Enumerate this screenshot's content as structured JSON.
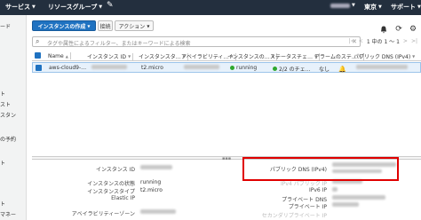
{
  "topbar": {
    "services": "サービス",
    "resource_groups": "リソースグループ",
    "region": "東京",
    "support": "サポート"
  },
  "sidebar": {
    "items": [
      "ード",
      "ト",
      "スト",
      "スタン",
      "の予約",
      "ト",
      "ト",
      "マネー"
    ]
  },
  "toolbar": {
    "launch_label": "インスタンスの作成",
    "connect_label": "接続",
    "actions_label": "アクション"
  },
  "filter": {
    "placeholder": "タグや属性によるフィルター、またはキーワードによる検索",
    "pager": "1 中の 1 ～ 1"
  },
  "table": {
    "columns": [
      "Name",
      "インスタンス ID",
      "インスタンスタ…",
      "アベイラビリティ…",
      "インスタンスの…",
      "ステータスチェ…",
      "アラームのステ…",
      "パブリック DNS (IPv4)"
    ],
    "rows": [
      {
        "name": "aws-cloud9-…",
        "type": "t2.micro",
        "state": "running",
        "status": "2/2 のチェ…",
        "alarm": "なし"
      }
    ]
  },
  "details": {
    "left": [
      {
        "label": "インスタンス ID",
        "value": ""
      },
      {
        "label": "インスタンスの状態",
        "value": "running"
      },
      {
        "label": "インスタンスタイプ",
        "value": "t2.micro"
      },
      {
        "label": "Elastic IP",
        "value": ""
      },
      {
        "label": "アベイラビリティーゾーン",
        "value": ""
      }
    ],
    "right": [
      {
        "label": "パブリック DNS (IPv4)"
      },
      {
        "label": "IPv4 パブリック IP"
      },
      {
        "label": "IPv6 IP"
      },
      {
        "label": "プライベート DNS"
      },
      {
        "label": "プライベート IP"
      },
      {
        "label": "セカンダリプライベート IP"
      }
    ]
  },
  "colors": {
    "topbar": "#232f3e",
    "primary": "#1f72c1",
    "running": "#2ea82e",
    "status_ok": "#2ea82e",
    "alarm_bell": "#d4a017",
    "highlight": "#e00000"
  }
}
